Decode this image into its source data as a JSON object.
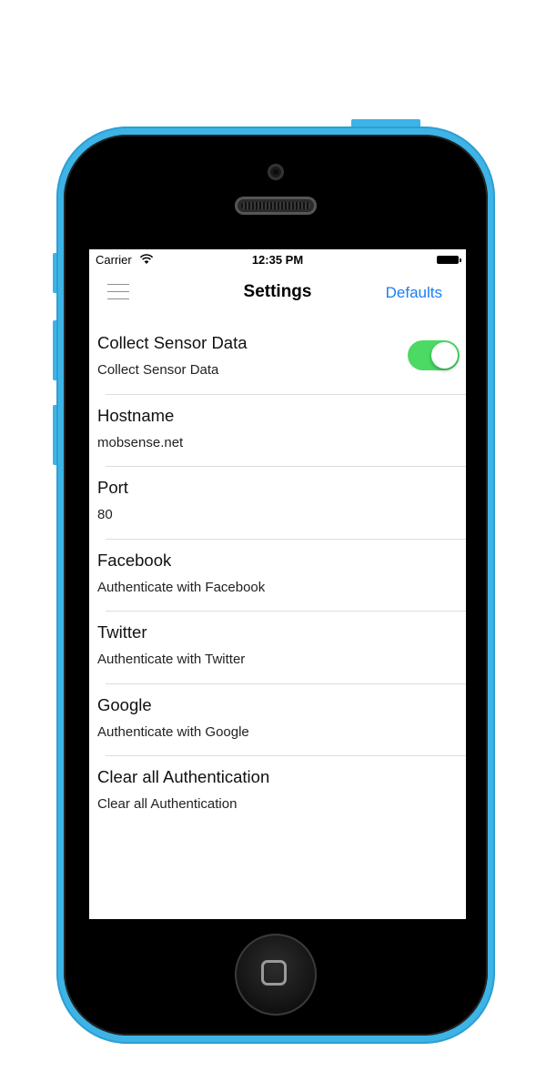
{
  "status_bar": {
    "carrier": "Carrier",
    "time": "12:35 PM"
  },
  "nav": {
    "title": "Settings",
    "right_button": "Defaults"
  },
  "settings": [
    {
      "title": "Collect Sensor Data",
      "subtitle": "Collect Sensor Data",
      "toggle": true
    },
    {
      "title": "Hostname",
      "subtitle": "mobsense.net"
    },
    {
      "title": "Port",
      "subtitle": "80"
    },
    {
      "title": "Facebook",
      "subtitle": "Authenticate with Facebook"
    },
    {
      "title": "Twitter",
      "subtitle": "Authenticate with Twitter"
    },
    {
      "title": "Google",
      "subtitle": "Authenticate with Google"
    },
    {
      "title": "Clear all Authentication",
      "subtitle": "Clear all Authentication"
    }
  ],
  "colors": {
    "device_shell": "#3db3e6",
    "accent": "#1a7ef7",
    "toggle_on": "#4cd964"
  },
  "icons": [
    "wifi-icon",
    "battery-icon",
    "menu-icon",
    "home-button-icon"
  ]
}
